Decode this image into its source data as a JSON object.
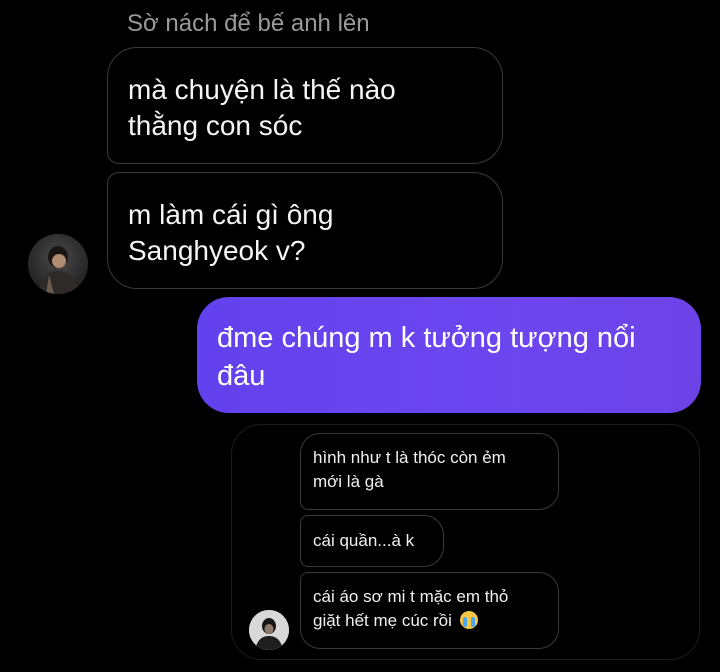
{
  "thread": {
    "sender_name": "Sờ nách để bế anh lên",
    "incoming": [
      {
        "lines": [
          "mà chuyện là thế nào",
          "thằng con sóc"
        ]
      },
      {
        "lines": [
          "m làm cái gì ông",
          "Sanghyeok v?"
        ]
      }
    ],
    "outgoing": [
      {
        "lines": [
          "đme chúng m k tưởng tượng nổi",
          "đâu"
        ]
      }
    ]
  },
  "shared_message_card": {
    "messages": [
      {
        "lines": [
          "hình như t là thóc còn ẻm",
          "mới là gà"
        ]
      },
      {
        "lines": [
          "cái quần...à k"
        ]
      },
      {
        "lines": [
          "cái áo sơ mi t mặc em thỏ",
          "giặt hết mẹ cúc rồi"
        ],
        "trailing_icon": "loudly-crying-face-emoji"
      }
    ]
  },
  "colors": {
    "background": "#000000",
    "outgoing_bubble": "#6a44ef",
    "incoming_border": "#3a3a3a",
    "sender_name": "#9a9a9a"
  }
}
